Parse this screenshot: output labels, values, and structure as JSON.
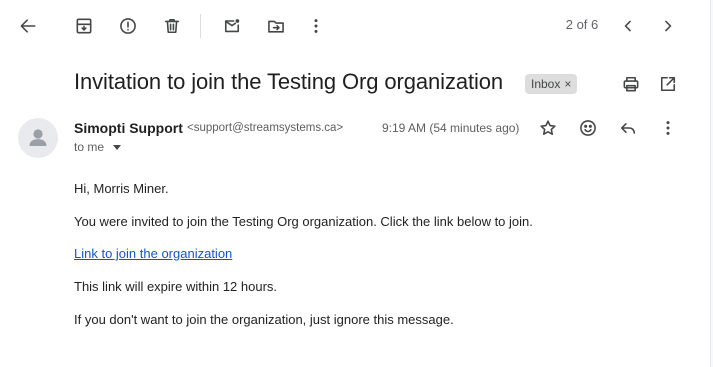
{
  "toolbar": {
    "back_icon": "arrow-left-icon",
    "archive_icon": "archive-icon",
    "report_icon": "report-spam-icon",
    "delete_icon": "trash-icon",
    "unread_icon": "mark-unread-icon",
    "move_icon": "move-to-icon",
    "more_icon": "more-vert-icon"
  },
  "pager": {
    "text": "2 of 6",
    "prev_icon": "chevron-left-icon",
    "next_icon": "chevron-right-icon"
  },
  "message": {
    "subject": "Invitation to join the Testing Org organization",
    "label": "Inbox",
    "label_close": "×",
    "sender_name": "Simopti Support",
    "sender_email": "<support@streamsystems.ca>",
    "timestamp": "9:19 AM (54 minutes ago)",
    "recipient": "to me",
    "body": {
      "greeting": "Hi, Morris Miner.",
      "line1": "You were invited to join the Testing Org organization. Click the link below to join.",
      "link": "Link to join the organization",
      "line2": "This link will expire within 12 hours.",
      "line3": "If you don't want to join the organization, just ignore this message."
    }
  },
  "colors": {
    "link": "#1155cc",
    "label_chip": "#dddddd",
    "icon": "#444746"
  }
}
